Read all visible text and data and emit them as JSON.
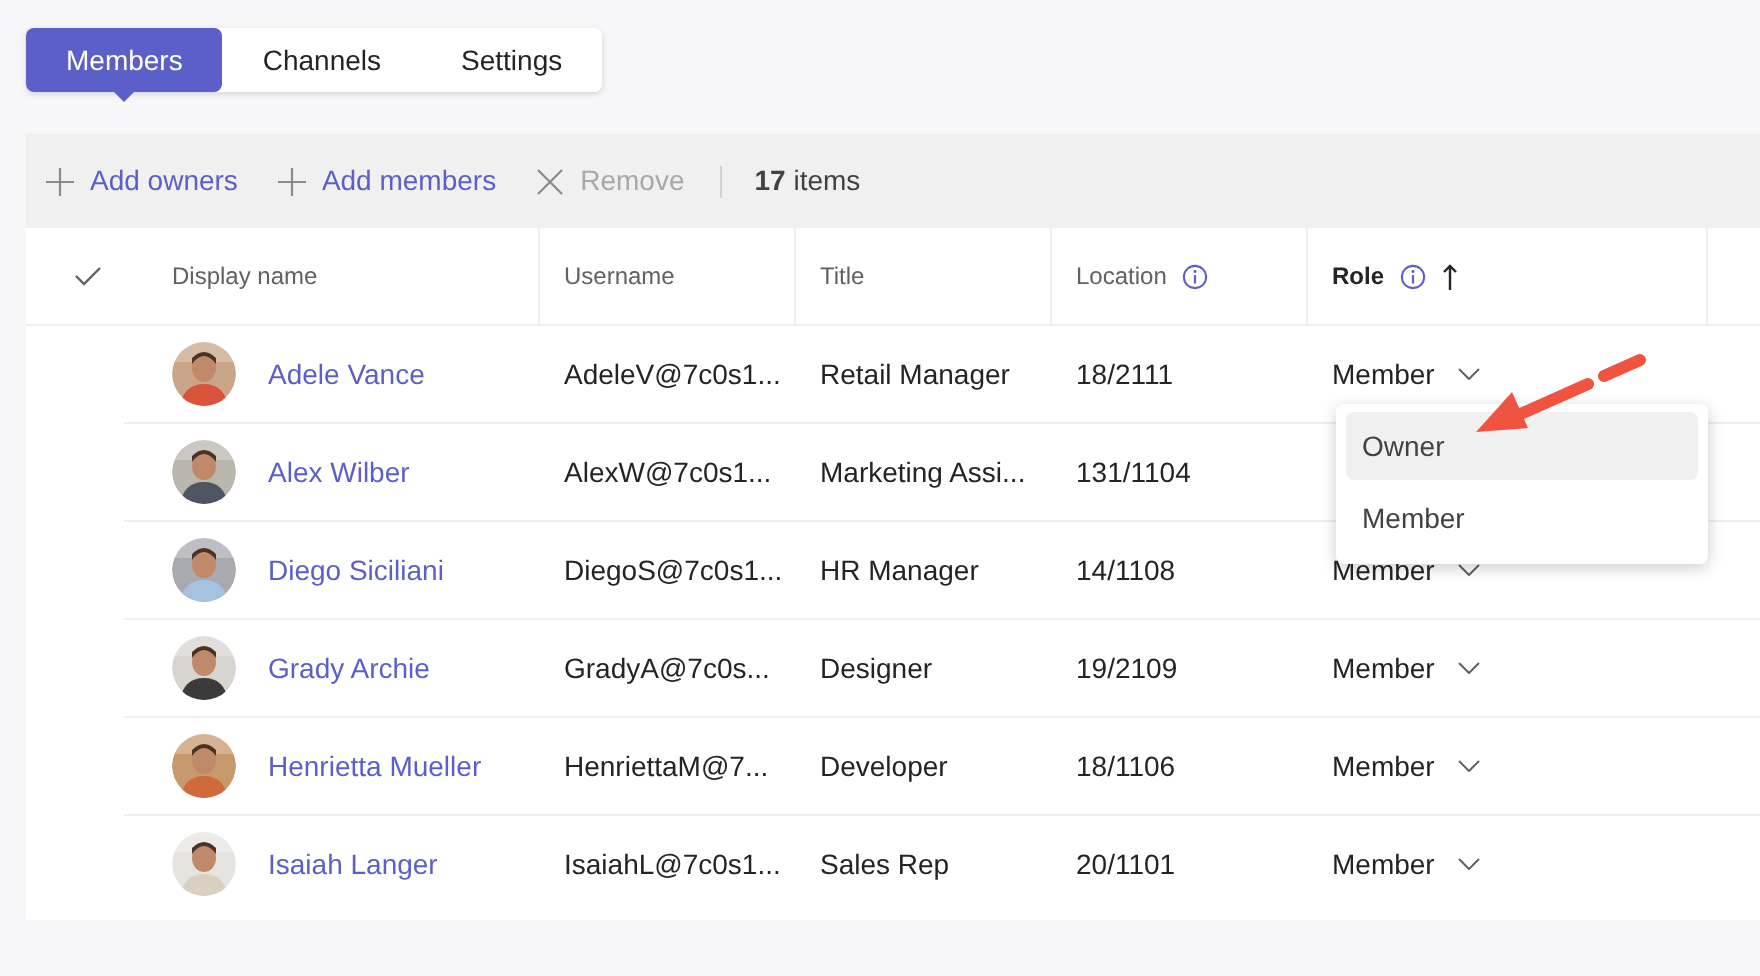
{
  "tabs": [
    {
      "label": "Members",
      "selected": true
    },
    {
      "label": "Channels",
      "selected": false
    },
    {
      "label": "Settings",
      "selected": false
    }
  ],
  "toolbar": {
    "actions": [
      {
        "label": "Add owners",
        "kind": "add",
        "disabled": false
      },
      {
        "label": "Add members",
        "kind": "add",
        "disabled": false
      },
      {
        "label": "Remove",
        "kind": "remove",
        "disabled": true
      }
    ],
    "count": "17",
    "count_label": "items"
  },
  "table": {
    "columns": [
      {
        "label": "Display name",
        "info": false,
        "sorted": false
      },
      {
        "label": "Username",
        "info": false,
        "sorted": false
      },
      {
        "label": "Title",
        "info": false,
        "sorted": false
      },
      {
        "label": "Location",
        "info": true,
        "sorted": false
      },
      {
        "label": "Role",
        "info": true,
        "sorted": true
      }
    ],
    "rows": [
      {
        "name": "Adele Vance",
        "username": "AdeleV@7c0s1...",
        "title": "Retail Manager",
        "location": "18/2111",
        "role": "Member"
      },
      {
        "name": "Alex Wilber",
        "username": "AlexW@7c0s1...",
        "title": "Marketing Assi...",
        "location": "131/1104"
      },
      {
        "name": "Diego Siciliani",
        "username": "DiegoS@7c0s1...",
        "title": "HR Manager",
        "location": "14/1108",
        "role": "Member"
      },
      {
        "name": "Grady Archie",
        "username": "GradyA@7c0s...",
        "title": "Designer",
        "location": "19/2109",
        "role": "Member"
      },
      {
        "name": "Henrietta Mueller",
        "username": "HenriettaM@7...",
        "title": "Developer",
        "location": "18/1106",
        "role": "Member"
      },
      {
        "name": "Isaiah Langer",
        "username": "IsaiahL@7c0s1...",
        "title": "Sales Rep",
        "location": "20/1101",
        "role": "Member"
      }
    ]
  },
  "role_menu": {
    "options": [
      {
        "label": "Owner",
        "selected": true
      },
      {
        "label": "Member",
        "selected": false
      }
    ]
  }
}
